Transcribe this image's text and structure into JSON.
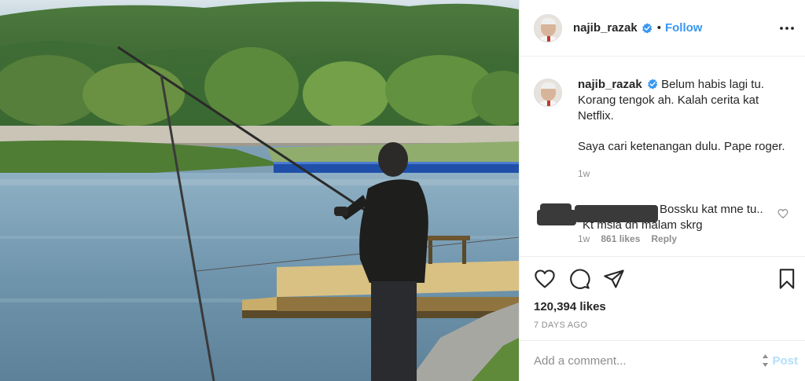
{
  "header": {
    "username": "najib_razak",
    "separator": "•",
    "follow_label": "Follow"
  },
  "caption": {
    "username": "najib_razak",
    "lines": [
      "Belum habis lagi tu.",
      "Korang tengok ah. Kalah cerita kat",
      "Netflix."
    ],
    "line2": "Saya cari ketenangan dulu. Pape roger.",
    "time": "1w"
  },
  "comment": {
    "text_line1": "Bossku kat mne tu..",
    "text_line2": "Kt msia dh malam skrg",
    "time": "1w",
    "likes": "861 likes",
    "reply_label": "Reply"
  },
  "post": {
    "likes": "120,394 likes",
    "posted": "7 DAYS AGO"
  },
  "add_comment": {
    "placeholder": "Add a comment...",
    "post_label": "Post"
  },
  "colors": {
    "link_blue": "#3897f0",
    "post_disabled": "#b2dffc",
    "verified_blue": "#3897f0",
    "muted": "#8e8e8e"
  },
  "icons": [
    "verified-badge-icon",
    "more-options-icon",
    "heart-icon",
    "comment-icon",
    "share-icon",
    "bookmark-icon"
  ]
}
